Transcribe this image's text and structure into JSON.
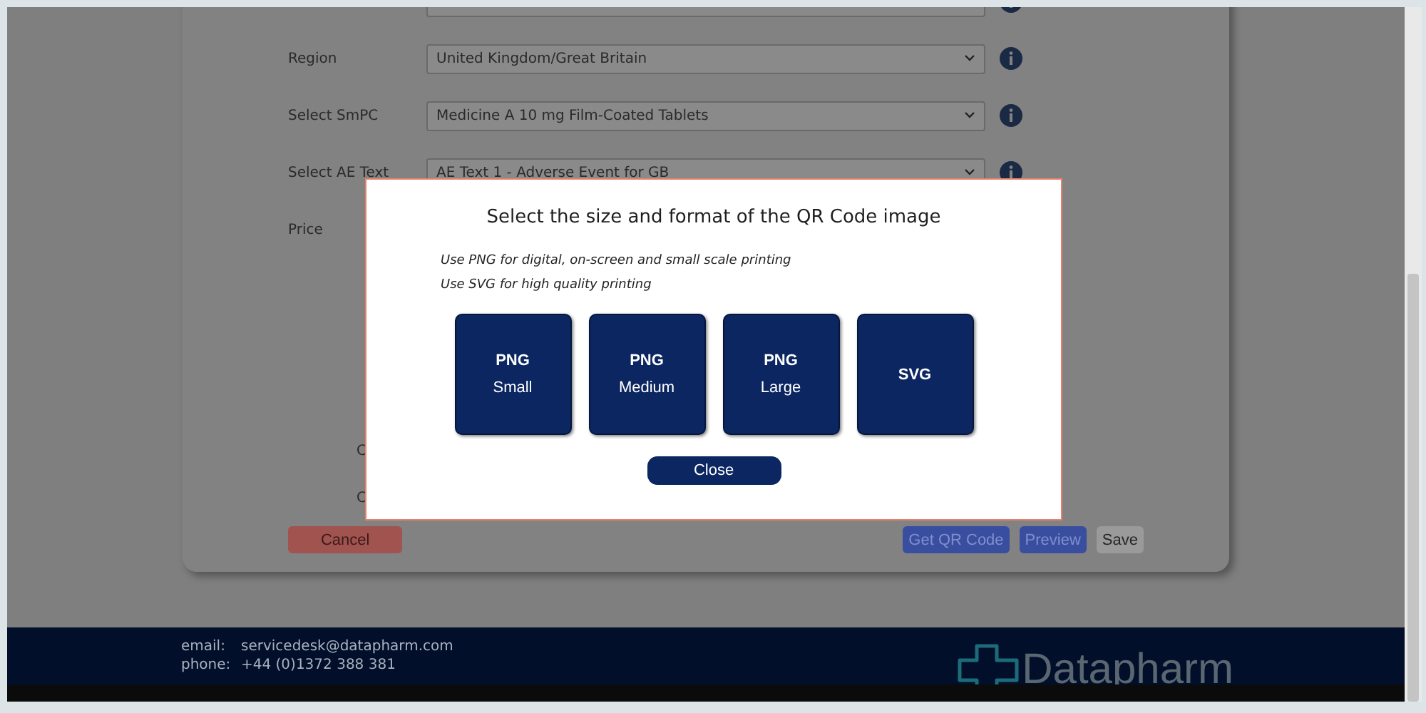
{
  "form": {
    "rows": [
      {
        "label": "",
        "value": ""
      },
      {
        "label": "Region",
        "value": "United Kingdom/Great Britain"
      },
      {
        "label": "Select SmPC",
        "value": "Medicine A 10 mg Film-Coated Tablets"
      },
      {
        "label": "Select AE Text",
        "value": "AE Text 1 - Adverse Event for GB"
      }
    ],
    "price_label": "Price",
    "cut_labels": [
      "C",
      "C"
    ],
    "buttons": [
      {
        "label": "Cancel",
        "kind": "danger"
      },
      {
        "label": "Get QR Code",
        "kind": "primary"
      },
      {
        "label": "Preview",
        "kind": "primary"
      },
      {
        "label": "Save",
        "kind": "neutral"
      }
    ]
  },
  "modal": {
    "title": "Select the size and format of the QR Code image",
    "notes": [
      "Use PNG for digital, on-screen and small scale printing",
      "Use SVG for high quality printing"
    ],
    "options": [
      {
        "format": "PNG",
        "size": "Small"
      },
      {
        "format": "PNG",
        "size": "Medium"
      },
      {
        "format": "PNG",
        "size": "Large"
      },
      {
        "format": "SVG"
      }
    ],
    "close": "Close"
  },
  "footer": {
    "contacts": [
      {
        "label": "email:",
        "value": "servicedesk@datapharm.com"
      },
      {
        "label": "phone:",
        "value": "+44 (0)1372 388 381"
      }
    ],
    "logo": "Datapharm"
  }
}
